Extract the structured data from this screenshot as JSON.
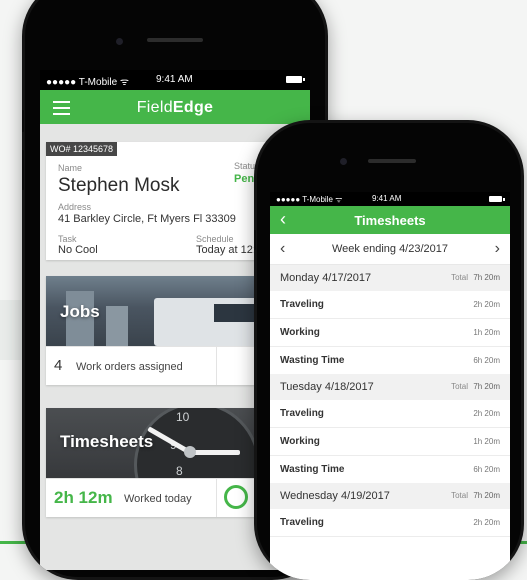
{
  "back_phone": {
    "status": {
      "carrier": "●●●●● T-Mobile ᯤ",
      "time": "9:41 AM"
    },
    "app_title_prefix": "Field",
    "app_title_bold": "Edge",
    "work_order": {
      "badge": "WO# 12345678",
      "name_label": "Name",
      "name": "Stephen Mosk",
      "status_label": "Status",
      "status": "Pending",
      "address_label": "Address",
      "address": "41 Barkley Circle, Ft Myers Fl 33309",
      "task_label": "Task",
      "task": "No Cool",
      "schedule_label": "Schedule",
      "schedule": "Today at 12:00"
    },
    "jobs_tile": {
      "label": "Jobs",
      "count": "4",
      "text": "Work orders assigned"
    },
    "timesheets_tile": {
      "label": "Timesheets",
      "hours": "2h 12m",
      "text": "Worked today",
      "clock_numbers": [
        "10",
        "9",
        "8"
      ]
    }
  },
  "front_phone": {
    "status": {
      "carrier": "●●●●● T-Mobile ᯤ",
      "time": "9:41 AM"
    },
    "title": "Timesheets",
    "back_icon": "chevron-left-icon",
    "week_label": "Week ending 4/23/2017",
    "prev_icon": "chevron-left-icon",
    "next_icon": "chevron-right-icon",
    "total_label": "Total",
    "days": [
      {
        "name": "Monday 4/17/2017",
        "total": "7h 20m",
        "rows": [
          {
            "label": "Traveling",
            "time": "2h 20m"
          },
          {
            "label": "Working",
            "time": "1h 20m"
          },
          {
            "label": "Wasting Time",
            "time": "6h 20m"
          }
        ]
      },
      {
        "name": "Tuesday 4/18/2017",
        "total": "7h 20m",
        "rows": [
          {
            "label": "Traveling",
            "time": "2h 20m"
          },
          {
            "label": "Working",
            "time": "1h 20m"
          },
          {
            "label": "Wasting Time",
            "time": "6h 20m"
          }
        ]
      },
      {
        "name": "Wednesday 4/19/2017",
        "total": "7h 20m",
        "rows": [
          {
            "label": "Traveling",
            "time": "2h 20m"
          }
        ]
      }
    ]
  },
  "colors": {
    "brand_green": "#45b649",
    "background": "#f4f5f4"
  }
}
